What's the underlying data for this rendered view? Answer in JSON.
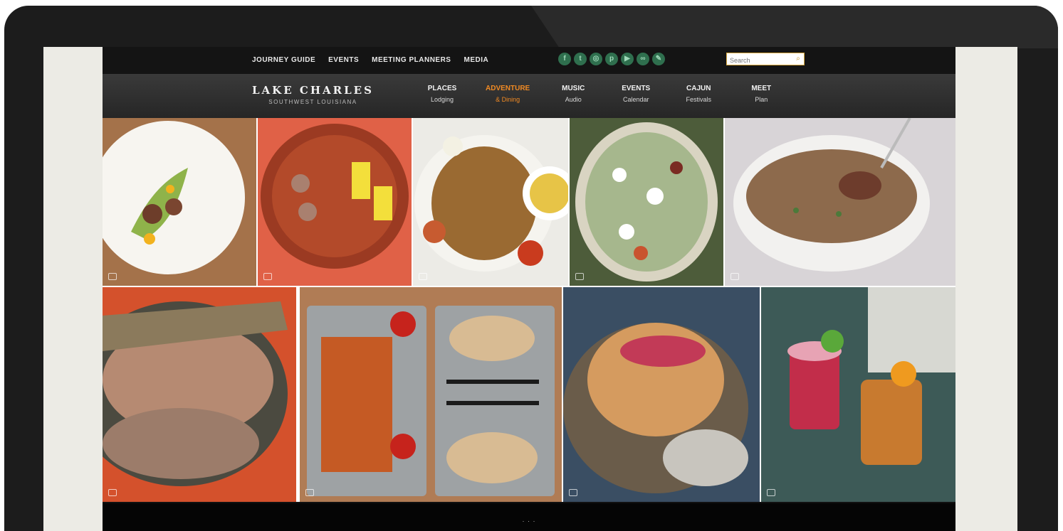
{
  "topbar": {
    "links": [
      {
        "label": "JOURNEY GUIDE"
      },
      {
        "label": "EVENTS"
      },
      {
        "label": "MEETING PLANNERS"
      },
      {
        "label": "MEDIA"
      }
    ],
    "social_icons": [
      "facebook-icon",
      "twitter-icon",
      "instagram-icon",
      "pinterest-icon",
      "youtube-icon",
      "tripadvisor-icon",
      "blog-icon"
    ],
    "search": {
      "placeholder": "Search"
    }
  },
  "brand": {
    "title": "LAKE CHARLES",
    "tagline": "SOUTHWEST LOUISIANA"
  },
  "nav": {
    "items": [
      {
        "top": "Places",
        "bottom": "Lodging"
      },
      {
        "top": "Adventure",
        "bottom": "& Dining"
      },
      {
        "top": "Music",
        "bottom": "Audio"
      },
      {
        "top": "Events",
        "bottom": "Calendar"
      },
      {
        "top": "Cajun",
        "bottom": "Festivals"
      },
      {
        "top": "Meet",
        "bottom": "Plan"
      }
    ],
    "active_index": 1,
    "accent_color": "#f08a24"
  },
  "gallery": {
    "tiles": [
      {
        "name": "plated-appetizer-image",
        "icon": "camera-icon"
      },
      {
        "name": "crawfish-boil-image",
        "icon": "camera-icon"
      },
      {
        "name": "fried-platter-image",
        "icon": "camera-icon"
      },
      {
        "name": "loaded-salad-image",
        "icon": "camera-icon"
      },
      {
        "name": "gumbo-bowl-image",
        "icon": "camera-icon"
      },
      {
        "name": "boiled-crabs-image",
        "icon": "camera-icon"
      },
      {
        "name": "po-boy-trays-image",
        "icon": "camera-icon"
      },
      {
        "name": "seafood-plate-image",
        "icon": "camera-icon"
      },
      {
        "name": "cocktails-image",
        "icon": "camera-icon"
      }
    ]
  },
  "footer": {
    "text": "· · ·"
  }
}
